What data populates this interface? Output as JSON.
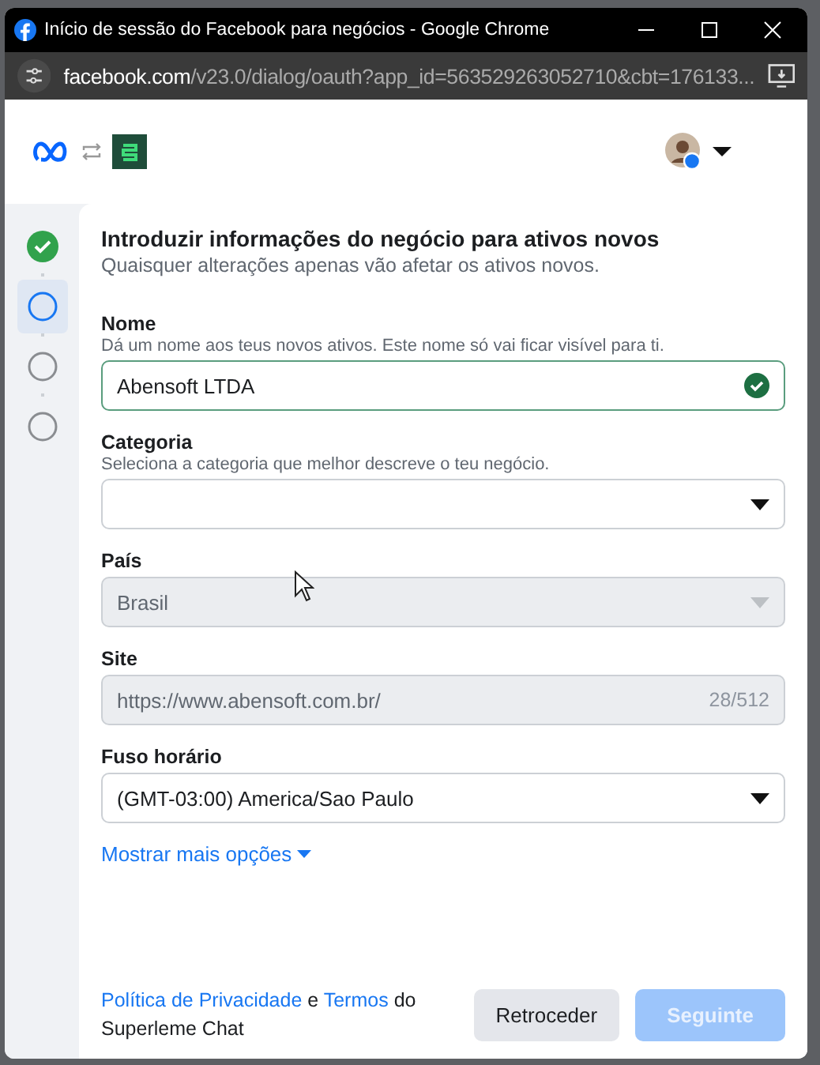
{
  "window": {
    "title": "Início de sessão do Facebook para negócios - Google Chrome"
  },
  "address_bar": {
    "domain": "facebook.com",
    "path": "/v23.0/dialog/oauth?app_id=563529263052710&cbt=176133..."
  },
  "steps": [
    {
      "kind": "done",
      "selected": false
    },
    {
      "kind": "current",
      "selected": true
    },
    {
      "kind": "pending",
      "selected": false
    },
    {
      "kind": "pending",
      "selected": false
    }
  ],
  "form": {
    "title": "Introduzir informações do negócio para ativos novos",
    "subtitle": "Quaisquer alterações apenas vão afetar os ativos novos.",
    "fields": [
      {
        "kind": "text",
        "label": "Nome",
        "hint": "Dá um nome aos teus novos ativos. Este nome só vai ficar visível para ti.",
        "value": "Abensoft LTDA",
        "valid": true,
        "disabled": false
      },
      {
        "kind": "select",
        "label": "Categoria",
        "hint": "Seleciona a categoria que melhor descreve o teu negócio.",
        "disabled": false
      },
      {
        "kind": "select",
        "label": "País",
        "value": "Brasil",
        "disabled": true
      },
      {
        "kind": "text",
        "label": "Site",
        "value": "https://www.abensoft.com.br/",
        "counter": "28/512",
        "disabled": true
      },
      {
        "kind": "select",
        "label": "Fuso horário",
        "value": "(GMT-03:00) America/Sao Paulo",
        "disabled": false
      }
    ],
    "more_link": "Mostrar mais opções"
  },
  "footer": {
    "parts": [
      {
        "kind": "link",
        "text": "Política de Privacidade"
      },
      {
        "kind": "text",
        "text": "e"
      },
      {
        "kind": "link",
        "text": "Termos"
      },
      {
        "kind": "text",
        "text": "do Superleme Chat"
      }
    ],
    "buttons": [
      {
        "label": "Retroceder",
        "disabled": false,
        "primary": false
      },
      {
        "label": "Seguinte",
        "disabled": true,
        "primary": true
      }
    ]
  }
}
